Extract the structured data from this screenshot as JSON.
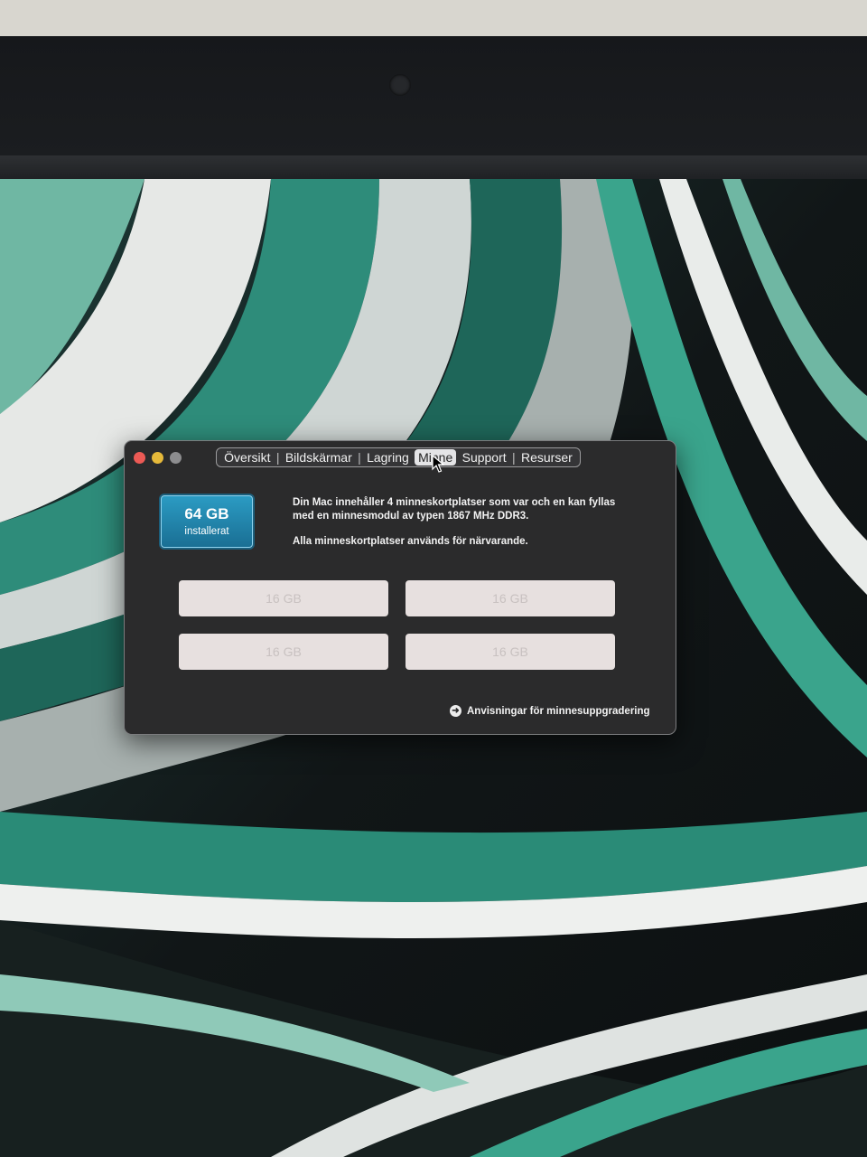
{
  "window": {
    "tabs": [
      {
        "label": "Översikt",
        "active": false
      },
      {
        "label": "Bildskärmar",
        "active": false
      },
      {
        "label": "Lagring",
        "active": false
      },
      {
        "label": "Minne",
        "active": true
      },
      {
        "label": "Support",
        "active": false
      },
      {
        "label": "Resurser",
        "active": false
      }
    ],
    "tab_separator": "|"
  },
  "memory": {
    "installed_size": "64 GB",
    "installed_label": "installerat",
    "description_line1": "Din Mac innehåller 4 minneskortplatser som var och en kan fyllas med en minnesmodul av typen 1867 MHz DDR3.",
    "description_line2": "Alla minneskortplatser används för närvarande.",
    "slots": [
      "16 GB",
      "16 GB",
      "16 GB",
      "16 GB"
    ],
    "upgrade_link": "Anvisningar för minnesuppgradering"
  },
  "icons": {
    "link_icon": "arrow-right-circle-icon",
    "cursor": "mouse-pointer-icon"
  },
  "colors": {
    "badge": "#1f83ad",
    "close": "#ec5a55",
    "minimize": "#e6b93a",
    "zoom": "#8d8d8f"
  }
}
